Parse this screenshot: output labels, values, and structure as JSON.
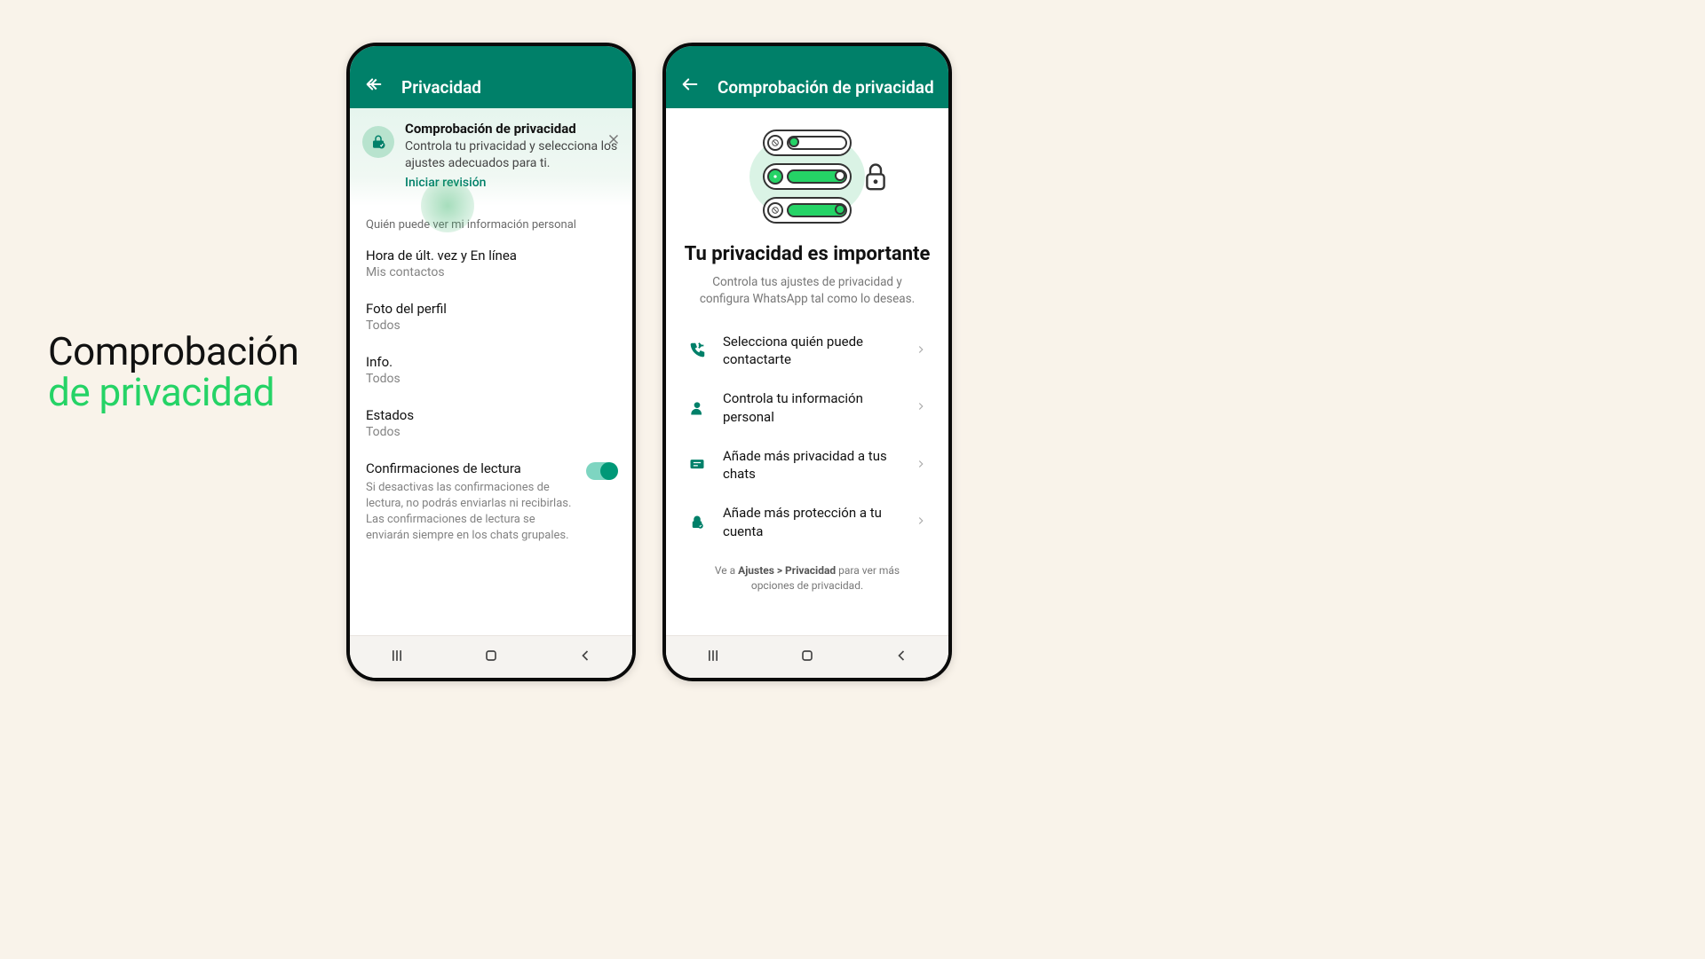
{
  "hero": {
    "line1": "Comprobación",
    "line2": "de privacidad"
  },
  "colors": {
    "brand": "#008069",
    "accent": "#25d366"
  },
  "phone1": {
    "appbar_title": "Privacidad",
    "banner": {
      "title": "Comprobación de privacidad",
      "desc": "Controla tu privacidad y selecciona los ajustes adecuados para ti.",
      "link": "Iniciar revisión"
    },
    "section": "Quién puede ver mi información personal",
    "rows": {
      "r1": {
        "label": "Hora de últ. vez y En línea",
        "value": "Mis contactos"
      },
      "r2": {
        "label": "Foto del perfil",
        "value": "Todos"
      },
      "r3": {
        "label": "Info.",
        "value": "Todos"
      },
      "r4": {
        "label": "Estados",
        "value": "Todos"
      },
      "r5": {
        "label": "Confirmaciones de lectura",
        "desc": "Si desactivas las confirmaciones de lectura, no podrás enviarlas ni recibirlas. Las confirmaciones de lectura se enviarán siempre en los chats grupales."
      }
    },
    "read_receipts_on": true
  },
  "phone2": {
    "appbar_title": "Comprobación de privacidad",
    "heading": "Tu privacidad es importante",
    "subheading": "Controla tus ajustes de privacidad y configura WhatsApp tal como lo deseas.",
    "items": {
      "i1": "Selecciona quién puede contactarte",
      "i2": "Controla tu información personal",
      "i3": "Añade más privacidad a tus chats",
      "i4": "Añade más protección a tu cuenta"
    },
    "footer_pre": "Ve a ",
    "footer_bold": "Ajustes > Privacidad",
    "footer_post": " para ver más opciones de privacidad."
  }
}
